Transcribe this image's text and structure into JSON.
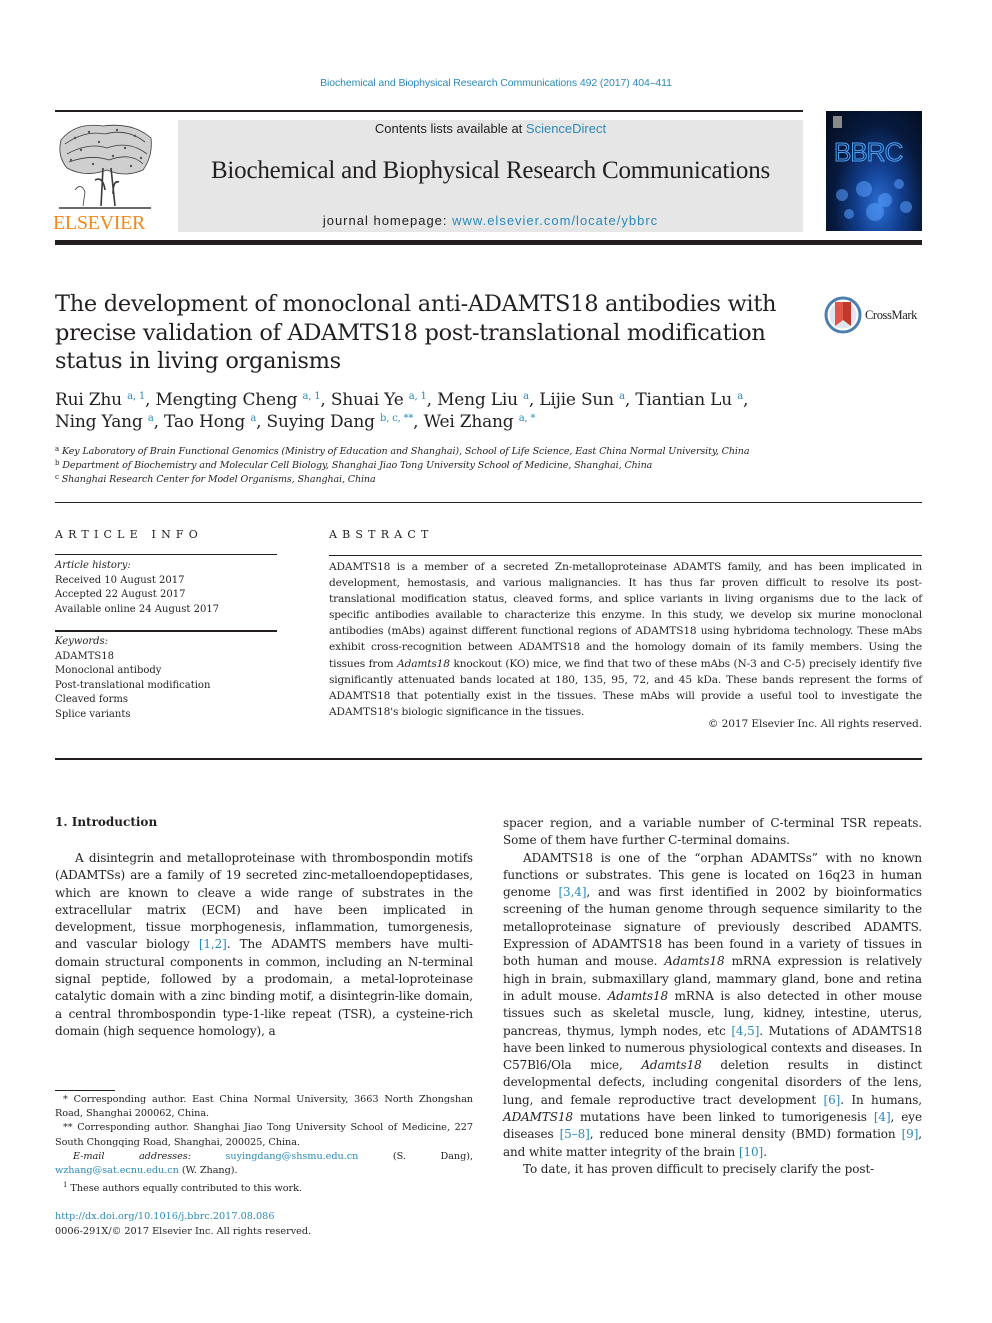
{
  "running_head": "Biochemical and Biophysical Research Communications 492 (2017) 404–411",
  "masthead": {
    "publisher_wordmark": "ELSEVIER",
    "contents_prefix": "Contents lists available at ",
    "contents_link": "ScienceDirect",
    "journal_title": "Biochemical and Biophysical Research Communications",
    "homepage_prefix": "journal homepage: ",
    "homepage_link": "www.elsevier.com/locate/ybbrc",
    "cover_title": "BBRC",
    "colors": {
      "elsevier_orange": "#f08a1c",
      "link_blue": "#2a8ab8",
      "masthead_gray": "#e6e6e6"
    }
  },
  "article": {
    "title": "The development of monoclonal anti-ADAMTS18 antibodies with precise validation of ADAMTS18 post-translational modification status in living organisms",
    "crossmark_label": "CrossMark",
    "authors": [
      {
        "name": "Rui Zhu",
        "affil": "a, 1"
      },
      {
        "name": "Mengting Cheng",
        "affil": "a, 1"
      },
      {
        "name": "Shuai Ye",
        "affil": "a, 1"
      },
      {
        "name": "Meng Liu",
        "affil": "a"
      },
      {
        "name": "Lijie Sun",
        "affil": "a"
      },
      {
        "name": "Tiantian Lu",
        "affil": "a"
      },
      {
        "name": "Ning Yang",
        "affil": "a"
      },
      {
        "name": "Tao Hong",
        "affil": "a"
      },
      {
        "name": "Suying Dang",
        "affil": "b, c, **"
      },
      {
        "name": "Wei Zhang",
        "affil": "a, *"
      }
    ],
    "affiliations": [
      {
        "mark": "a",
        "text": "Key Laboratory of Brain Functional Genomics (Ministry of Education and Shanghai), School of Life Science, East China Normal University, China"
      },
      {
        "mark": "b",
        "text": "Department of Biochemistry and Molecular Cell Biology, Shanghai Jiao Tong University School of Medicine, Shanghai, China"
      },
      {
        "mark": "c",
        "text": "Shanghai Research Center for Model Organisms, Shanghai, China"
      }
    ]
  },
  "article_info": {
    "heading": "ARTICLE INFO",
    "history_label": "Article history:",
    "history": [
      "Received 10 August 2017",
      "Accepted 22 August 2017",
      "Available online 24 August 2017"
    ],
    "keywords_label": "Keywords:",
    "keywords": [
      "ADAMTS18",
      "Monoclonal antibody",
      "Post-translational modification",
      "Cleaved forms",
      "Splice variants"
    ]
  },
  "abstract": {
    "heading": "ABSTRACT",
    "text_1": "ADAMTS18 is a member of a secreted Zn-metalloproteinase ADAMTS family, and has been implicated in development, hemostasis, and various malignancies. It has thus far proven difficult to resolve its post-translational modification status, cleaved forms, and splice variants in living organisms due to the lack of specific antibodies available to characterize this enzyme. In this study, we develop six murine monoclonal antibodies (mAbs) against different functional regions of ADAMTS18 using hybridoma technology. These mAbs exhibit cross-recognition between ADAMTS18 and the homology domain of its family members. Using the tissues from ",
    "text_italic": "Adamts18",
    "text_2": " knockout (KO) mice, we find that two of these mAbs (N-3 and C-5) precisely identify five significantly attenuated bands located at 180, 135, 95, 72, and 45 kDa. These bands represent the forms of ADAMTS18 that potentially exist in the tissues. These mAbs will provide a useful tool to investigate the ADAMTS18's biologic significance in the tissues.",
    "copyright": "© 2017 Elsevier Inc. All rights reserved."
  },
  "body": {
    "section_heading": "1.  Introduction",
    "left_p1_a": "A disintegrin and metalloproteinase with thrombospondin motifs (ADAMTSs) are a family of 19 secreted zinc-metalloendopeptidases, which are known to cleave a wide range of substrates in the extracellular matrix (ECM) and have been implicated in development, tissue morphogenesis, inflammation, tumorgenesis, and vascular biology ",
    "left_p1_cite1": "[1,2]",
    "left_p1_b": ". The ADAMTS members have multi-domain structural components in common, including an N-terminal signal peptide, followed by a prodomain, a metal-loproteinase catalytic domain with a zinc binding motif, a disintegrin-like domain, a central thrombospondin type-1-like repeat (TSR), a cysteine-rich domain (high sequence homology), a",
    "right_p1": "spacer region, and a variable number of C-terminal TSR repeats. Some of them have further C-terminal domains.",
    "right_p2_a": "ADAMTS18 is one of the “orphan ADAMTSs” with no known functions or substrates. This gene is located on 16q23 in human genome ",
    "right_p2_cite1": "[3,4]",
    "right_p2_b": ", and was first identified in 2002 by bioinformatics screening of the human genome through sequence similarity to the metalloproteinase signature of previously described ADAMTS. Expression of ADAMTS18 has been found in a variety of tissues in both human and mouse. ",
    "right_p2_it1": "Adamts18",
    "right_p2_c": " mRNA expression is relatively high in brain, submaxillary gland, mammary gland, bone and retina in adult mouse. ",
    "right_p2_it2": "Adamts18",
    "right_p2_d": " mRNA is also detected in other mouse tissues such as skeletal muscle, lung, kidney, intestine, uterus, pancreas, thymus, lymph nodes, etc ",
    "right_p2_cite2": "[4,5]",
    "right_p2_e": ". Mutations of ADAMTS18 have been linked to numerous physiological contexts and diseases. In C57Bl6/Ola mice, ",
    "right_p2_it3": "Adamts18",
    "right_p2_f": " deletion results in distinct developmental defects, including congenital disorders of the lens, lung, and female reproductive tract development ",
    "right_p2_cite3": "[6]",
    "right_p2_g": ". In humans, ",
    "right_p2_it4": "ADAMTS18",
    "right_p2_h": " mutations have been linked to tumorigenesis ",
    "right_p2_cite4": "[4]",
    "right_p2_i": ", eye diseases ",
    "right_p2_cite5": "[5–8]",
    "right_p2_j": ", reduced bone mineral density (BMD) formation ",
    "right_p2_cite6": "[9]",
    "right_p2_k": ", and white matter integrity of the brain ",
    "right_p2_cite7": "[10]",
    "right_p2_l": ".",
    "right_p3": "To date, it has proven difficult to precisely clarify the post-"
  },
  "footnotes": {
    "fn_star": "* Corresponding author. East China Normal University, 3663 North Zhongshan Road, Shanghai 200062, China.",
    "fn_dstar": "** Corresponding author. Shanghai Jiao Tong University School of Medicine, 227 South Chongqing Road, Shanghai, 200025, China.",
    "email_label": "E-mail addresses:",
    "email_1": "suyingdang@shsmu.edu.cn",
    "email_1_who": " (S. Dang), ",
    "email_2": "wzhang@sat.ecnu.edu.cn",
    "email_2_who": " (W. Zhang).",
    "fn_1_mark": "1",
    "fn_1": " These authors equally contributed to this work.",
    "doi": "http://dx.doi.org/10.1016/j.bbrc.2017.08.086",
    "issn": "0006-291X/© 2017 Elsevier Inc. All rights reserved."
  }
}
